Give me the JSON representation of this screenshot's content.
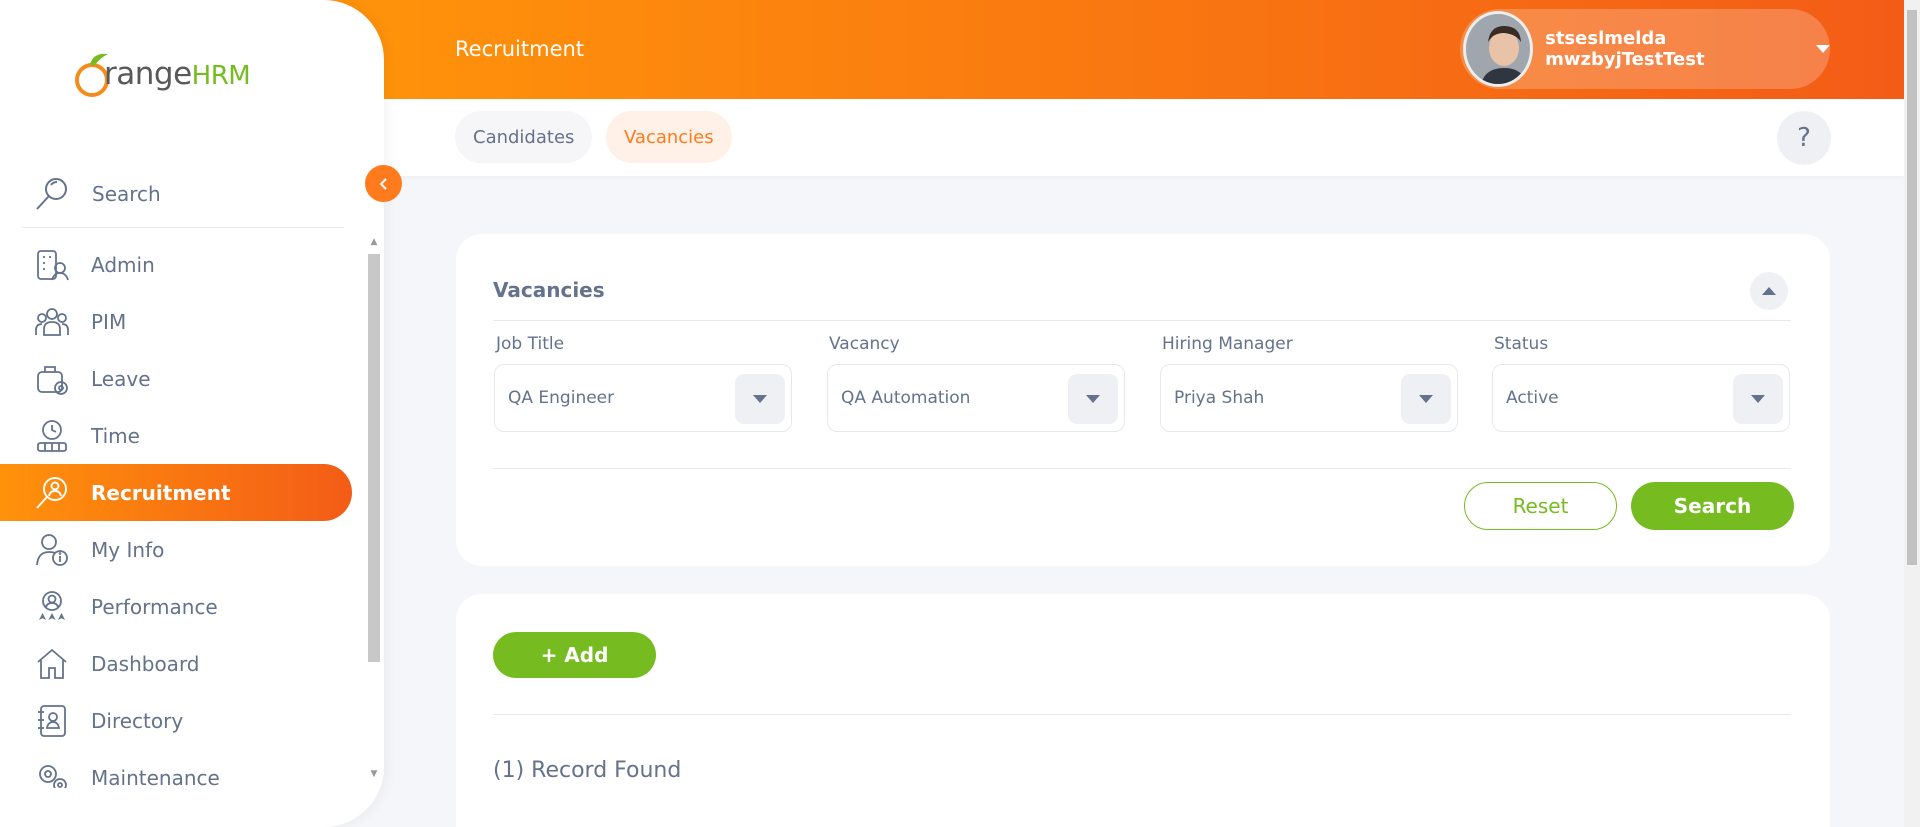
{
  "brand": {
    "name": "range",
    "suffix": "HRM"
  },
  "sidebar": {
    "search_label": "Search",
    "items": [
      {
        "label": "Admin",
        "icon": "admin-icon"
      },
      {
        "label": "PIM",
        "icon": "pim-icon"
      },
      {
        "label": "Leave",
        "icon": "leave-icon"
      },
      {
        "label": "Time",
        "icon": "time-icon"
      },
      {
        "label": "Recruitment",
        "icon": "recruitment-icon",
        "active": true
      },
      {
        "label": "My Info",
        "icon": "my-info-icon"
      },
      {
        "label": "Performance",
        "icon": "performance-icon"
      },
      {
        "label": "Dashboard",
        "icon": "dashboard-icon"
      },
      {
        "label": "Directory",
        "icon": "directory-icon"
      },
      {
        "label": "Maintenance",
        "icon": "maintenance-icon"
      }
    ]
  },
  "header": {
    "title": "Recruitment",
    "user_name": "stseslmelda mwzbyjTestTest"
  },
  "subnav": {
    "tabs": [
      {
        "label": "Candidates"
      },
      {
        "label": "Vacancies",
        "active": true
      }
    ],
    "help_label": "?"
  },
  "filters": {
    "title": "Vacancies",
    "fields": [
      {
        "label": "Job Title",
        "value": "QA Engineer"
      },
      {
        "label": "Vacancy",
        "value": "QA Automation"
      },
      {
        "label": "Hiring Manager",
        "value": "Priya Shah"
      },
      {
        "label": "Status",
        "value": "Active"
      }
    ],
    "reset_label": "Reset",
    "search_label": "Search"
  },
  "results": {
    "add_label": "+  Add",
    "record_count": "(1) Record Found"
  },
  "colors": {
    "accent": "#ff7b1d",
    "header_start": "#ff920b",
    "header_end": "#f35c17",
    "primary_green": "#76bc21",
    "text": "#64728c"
  }
}
